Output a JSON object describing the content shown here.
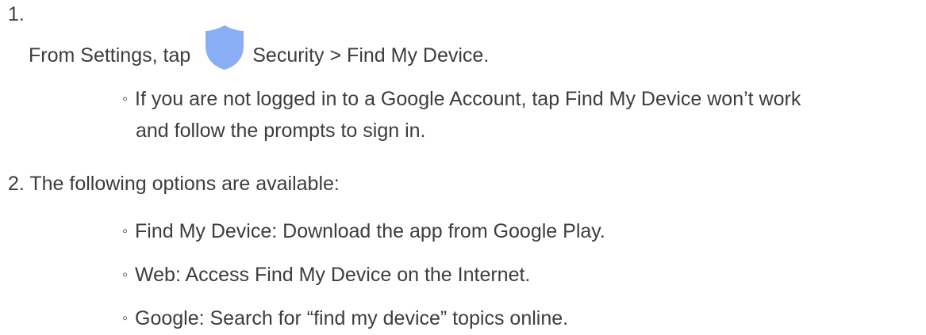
{
  "step1": {
    "number": "1.",
    "text_before": "From Settings, tap",
    "icon": "shield-icon",
    "icon_color": "#8aaef5",
    "text_after": "Security > Find My Device."
  },
  "sub1": {
    "bullet": "◦",
    "line1": "If you are not logged in to a Google Account, tap Find My Device won’t work",
    "line2": "and follow the prompts to sign in."
  },
  "step2": {
    "text": "2. The following options are available:"
  },
  "options": [
    {
      "bullet": "◦",
      "text": "Find My Device: Download the app from Google Play."
    },
    {
      "bullet": "◦",
      "text": "Web: Access Find My Device on the Internet."
    },
    {
      "bullet": "◦",
      "text": "Google: Search for “find my device” topics online."
    }
  ]
}
